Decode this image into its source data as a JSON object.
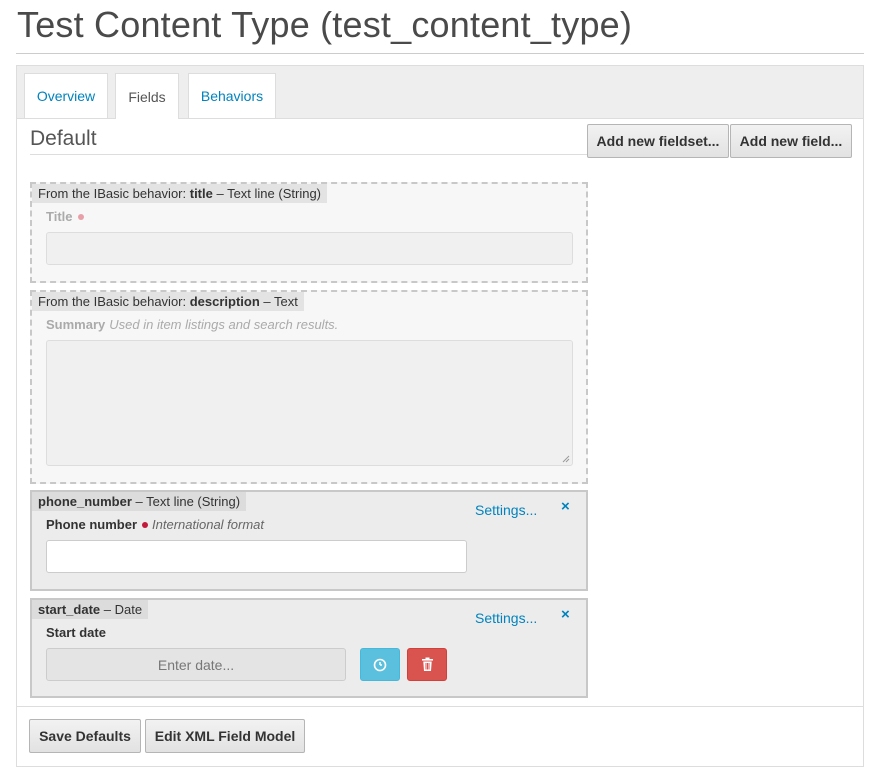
{
  "page": {
    "title": "Test Content Type (test_content_type)"
  },
  "tabs": [
    {
      "label": "Overview",
      "active": false
    },
    {
      "label": "Fields",
      "active": true
    },
    {
      "label": "Behaviors",
      "active": false
    }
  ],
  "fieldset": {
    "legend": "Default",
    "add_fieldset_label": "Add new fieldset...",
    "add_field_label": "Add new field..."
  },
  "fields": [
    {
      "header_prefix": "From the IBasic behavior: ",
      "header_name": "title",
      "header_type": " – Text line (String)",
      "label": "Title",
      "help": "",
      "required": true
    },
    {
      "header_prefix": "From the IBasic behavior: ",
      "header_name": "description",
      "header_type": " – Text",
      "label": "Summary",
      "help": "Used in item listings and search results.",
      "required": false
    },
    {
      "header_name": "phone_number",
      "header_type": " – Text line (String)",
      "label": "Phone number",
      "help": "International format",
      "required": true,
      "settings_label": "Settings...",
      "close_glyph": "×"
    },
    {
      "header_name": "start_date",
      "header_type": " – Date",
      "label": "Start date",
      "help": "",
      "required": false,
      "settings_label": "Settings...",
      "close_glyph": "×",
      "date_placeholder": "Enter date..."
    }
  ],
  "footer": {
    "save_defaults_label": "Save Defaults",
    "edit_xml_label": "Edit XML Field Model"
  },
  "icons": {
    "clock": "clock-icon",
    "trash": "trash-icon"
  },
  "colors": {
    "link": "#0083be",
    "info_button": "#5bc0de",
    "danger_button": "#d9534f",
    "required_dot": "#c4183c"
  }
}
